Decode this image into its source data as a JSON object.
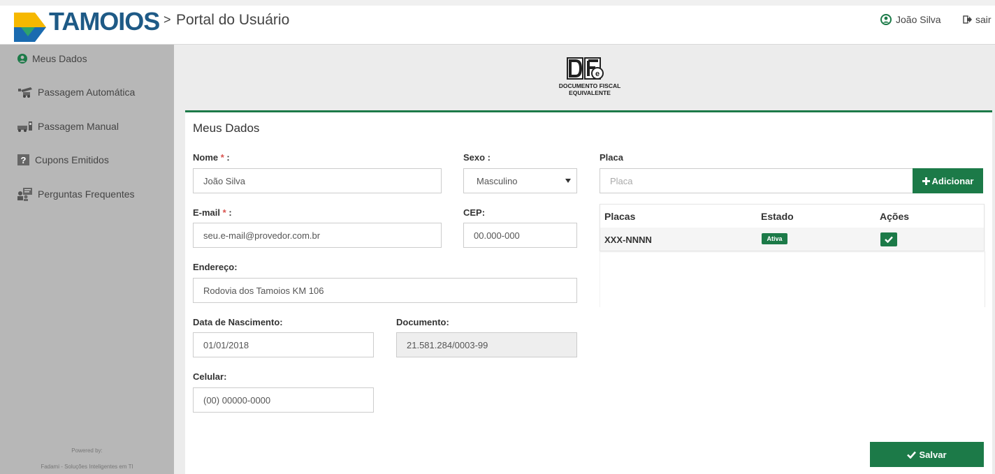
{
  "header": {
    "brand": "TAMOIOS",
    "separator": ">",
    "portal_title": "Portal do Usuário",
    "user_name": "João Silva",
    "logout_label": "sair"
  },
  "sidebar": {
    "items": [
      {
        "label": "Meus Dados",
        "icon": "user-circle-icon"
      },
      {
        "label": "Passagem Automática",
        "icon": "car-pass-automatic-icon"
      },
      {
        "label": "Passagem Manual",
        "icon": "car-pass-manual-icon"
      },
      {
        "label": "Cupons Emitidos",
        "icon": "question-box-icon"
      },
      {
        "label": "Perguntas Frequentes",
        "icon": "faq-people-icon"
      }
    ],
    "powered_by": "Powered by:",
    "powered_company": "Fadami - Soluções Inteligentes em TI"
  },
  "dfe_logo": {
    "line1": "DOCUMENTO FISCAL",
    "line2": "EQUIVALENTE"
  },
  "form": {
    "title": "Meus Dados",
    "nome_label": "Nome",
    "nome_value": "João Silva",
    "sexo_label": "Sexo :",
    "sexo_value": "Masculino",
    "email_label": "E-mail",
    "email_value": "seu.e-mail@provedor.com.br",
    "cep_label": "CEP:",
    "cep_value": "00.000-000",
    "endereco_label": "Endereço:",
    "endereco_value": "Rodovia dos Tamoios KM 106",
    "nascimento_label": "Data de Nascimento:",
    "nascimento_value": "01/01/2018",
    "documento_label": "Documento:",
    "documento_value": "21.581.284/0003-99",
    "celular_label": "Celular:",
    "celular_value": "(00) 00000-0000",
    "required_mark": "*",
    "required_suffix": " :",
    "save_label": "Salvar"
  },
  "placa": {
    "label": "Placa",
    "placeholder": "Placa",
    "add_label": "Adicionar",
    "table": {
      "headers": [
        "Placas",
        "Estado",
        "Ações"
      ],
      "rows": [
        {
          "placa": "XXX-NNNN",
          "estado": "Ativa"
        }
      ]
    }
  },
  "colors": {
    "accent_green": "#1c7a48",
    "brand_blue": "#1e5a86",
    "logo_yellow": "#f6b800",
    "logo_blue": "#1a6bb0",
    "sidebar_bg": "#b7b7b7"
  }
}
